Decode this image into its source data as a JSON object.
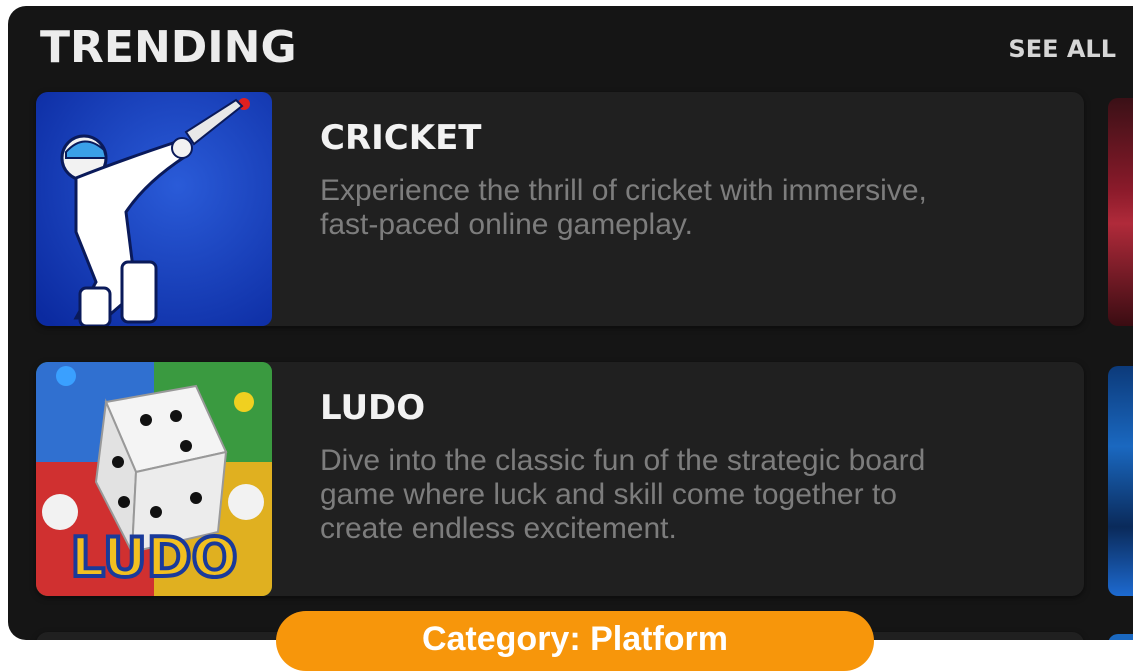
{
  "header": {
    "title": "TRENDING",
    "see_all_label": "SEE ALL"
  },
  "cards": [
    {
      "title": "CRICKET",
      "description": "Experience the thrill of cricket with immersive, fast-paced online gameplay.",
      "thumbnail_icon": "cricket-batsman-icon"
    },
    {
      "title": "LUDO",
      "description": "Dive into the classic fun of the strategic board game where luck and skill come together to create endless excitement.",
      "thumbnail_icon": "ludo-dice-icon",
      "thumbnail_text": "LUDO"
    }
  ],
  "badge": {
    "label": "Category: Platform"
  },
  "colors": {
    "background": "#151515",
    "card": "#202020",
    "accent": "#f7960b",
    "description_text": "#7d7d7d"
  }
}
